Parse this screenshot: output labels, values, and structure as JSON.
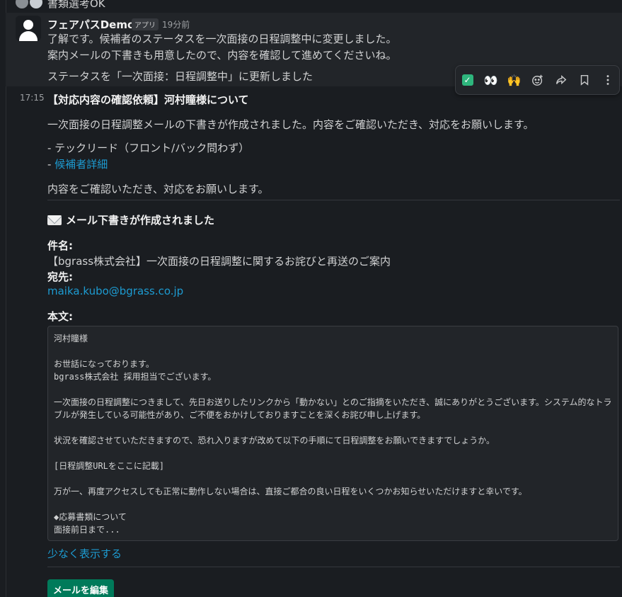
{
  "top": {
    "text": "書類選考OK"
  },
  "bot_message": {
    "sender": "フェアパスDemo",
    "badge": "アプリ",
    "time_ago": "19分前",
    "lines": [
      "了解です。候補者のステータスを一次面接の日程調整中に変更しました。",
      "案内メールの下書きも用意したので、内容を確認して進めてくださいね。",
      "ステータスを「一次面接：日程調整中」に更新しました"
    ]
  },
  "toolbar": {
    "items": [
      {
        "name": "check-mark-reaction",
        "glyph": "✓"
      },
      {
        "name": "eyes-reaction",
        "glyph": "👀"
      },
      {
        "name": "raised-hands-reaction",
        "glyph": "🙌"
      },
      {
        "name": "add-reaction",
        "glyph": "☺"
      },
      {
        "name": "share",
        "glyph": "↪"
      },
      {
        "name": "bookmark",
        "glyph": "🔖"
      },
      {
        "name": "more",
        "glyph": "⋮"
      }
    ]
  },
  "followup": {
    "timestamp": "17:15",
    "heading": "【対応内容の確認依頼】河村瞳様について",
    "intro": "一次面接の日程調整メールの下書きが作成されました。内容をご確認いただき、対応をお願いします。",
    "bullet1": "- テックリード（フロント/バック問わず）",
    "bullet2_prefix": "- ",
    "bullet2_link": "候補者詳細",
    "outro": "内容をご確認いただき、対応をお願いします。"
  },
  "draft": {
    "section_title": "メール下書きが作成されました",
    "subject_label": "件名:",
    "subject": "【bgrass株式会社】一次面接の日程調整に関するお詫びと再送のご案内",
    "to_label": "宛先:",
    "to": "maika.kubo@bgrass.co.jp",
    "body_label": "本文:",
    "body": "河村瞳様\n\nお世話になっております。\nbgrass株式会社 採用担当でございます。\n\n一次面接の日程調整につきまして、先日お送りしたリンクから「動かない」とのご指摘をいただき、誠にありがとうございます。システム的なトラブルが発生している可能性があり、ご不便をおかけしておりますことを深くお詫び申し上げます。\n\n状況を確認させていただきますので、恐れ入りますが改めて以下の手順にて日程調整をお願いできますでしょうか。\n\n[日程調整URLをここに記載]\n\n万が一、再度アクセスしても正常に動作しない場合は、直接ご都合の良い日程をいくつかお知らせいただけますと幸いです。\n\n◆応募書類について\n面接前日まで...",
    "show_less": "少なく表示する",
    "edit_button": "メールを編集"
  },
  "colors": {
    "background": "#1a1d21",
    "highlight": "#222529",
    "link": "#1d9bd1",
    "button": "#007a5a"
  }
}
